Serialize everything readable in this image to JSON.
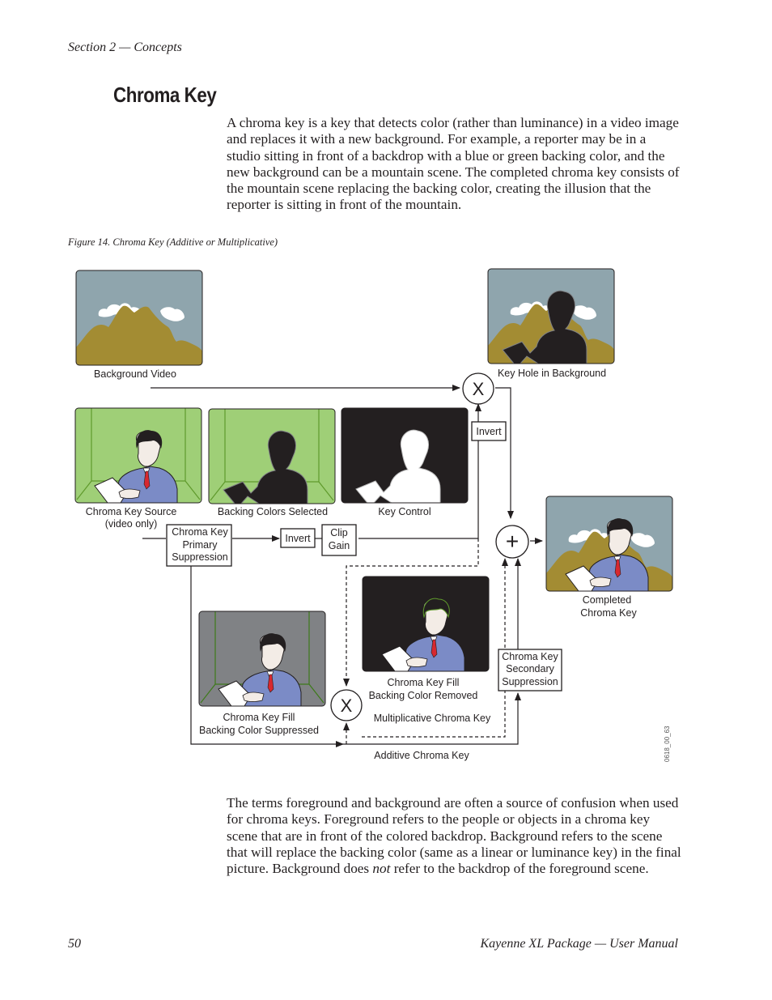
{
  "header": {
    "running_head": "Section 2 — Concepts"
  },
  "section": {
    "title": "Chroma Key"
  },
  "body": {
    "paragraph1": "A chroma key is a key that detects color (rather than luminance) in a video image and replaces it with a new background. For example, a reporter may be in a studio sitting in front of a backdrop with a blue or green backing color, and the new background can be a mountain scene. The completed chroma key consists of the mountain scene replacing the backing color, creating the illusion that the reporter is sitting in front of the mountain.",
    "paragraph2_before_emphasis": "The terms foreground and background are often a source of confusion when used for chroma keys. Foreground refers to the people or objects in a chroma key scene that are in front of the colored backdrop. Background refers to the scene that will replace the backing color (same as a linear or luminance key) in the final picture. Background does ",
    "paragraph2_emphasis": "not",
    "paragraph2_after_emphasis": " refer to the backdrop of the foreground scene."
  },
  "figure": {
    "caption": "Figure 14.  Chroma Key (Additive or Multiplicative)",
    "figure_id": "0618_00_63",
    "panels": {
      "background_video": [
        "Background Video"
      ],
      "key_hole": [
        "Key Hole in Background"
      ],
      "chroma_key_source": [
        "Chroma Key Source",
        "(video only)"
      ],
      "backing_colors_selected": [
        "Backing Colors Selected"
      ],
      "key_control": [
        "Key Control"
      ],
      "completed": [
        "Completed",
        "Chroma Key"
      ],
      "fill_removed": [
        "Chroma Key Fill",
        "Backing Color Removed"
      ],
      "fill_suppressed": [
        "Chroma Key Fill",
        "Backing Color Suppressed"
      ]
    },
    "blocks": {
      "primary_suppression": [
        "Chroma Key",
        "Primary",
        "Suppression"
      ],
      "invert_main": [
        "Invert"
      ],
      "clip_gain": [
        "Clip",
        "Gain"
      ],
      "invert_top": [
        "Invert"
      ],
      "secondary_suppression": [
        "Chroma Key",
        "Secondary",
        "Suppression"
      ]
    },
    "operators": {
      "multiply_top": "X",
      "adder": "+",
      "multiply_bottom": "X"
    },
    "path_labels": {
      "multiplicative": "Multiplicative Chroma Key",
      "additive": "Additive Chroma Key"
    },
    "colors": {
      "sky": "#8fa5ad",
      "mountain": "#a38c33",
      "green_backing": "#9fcf77",
      "green_line": "#5f9a2c",
      "suppressed_gray": "#808285",
      "black": "#231f20",
      "suit": "#7b8bc6",
      "tie": "#d7282f"
    }
  },
  "footer": {
    "page_number": "50",
    "doc_title": "Kayenne XL Package  —  User Manual"
  }
}
